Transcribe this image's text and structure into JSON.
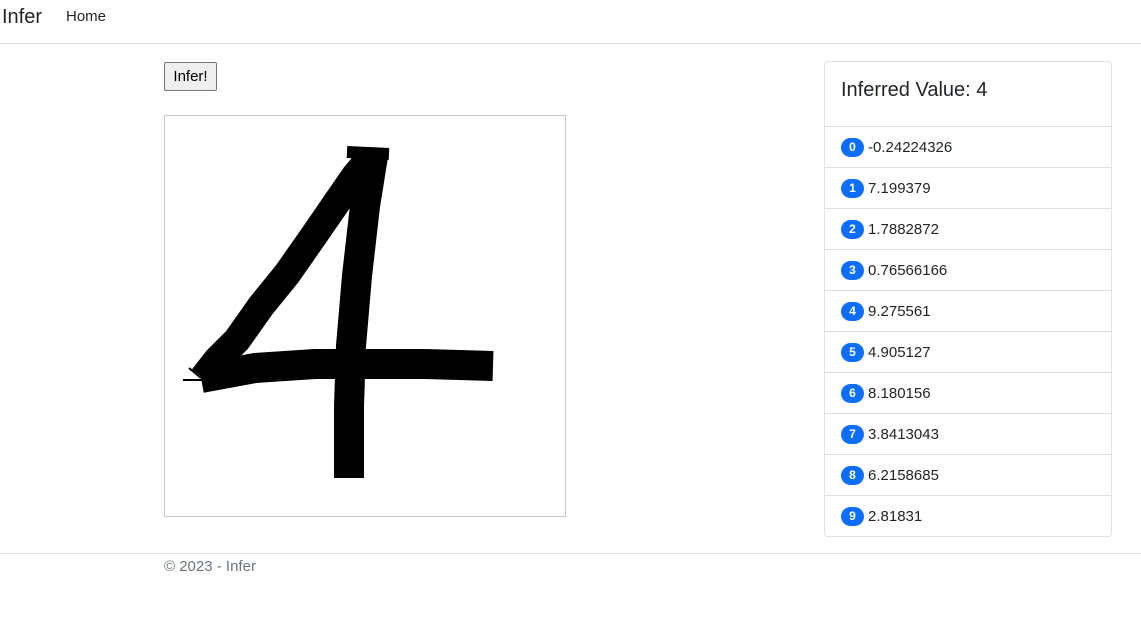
{
  "navbar": {
    "brand": "Infer",
    "links": [
      "Home"
    ]
  },
  "main": {
    "infer_button_label": "Infer!",
    "canvas": {
      "drawn_digit_icon": "handwritten-digit-4"
    }
  },
  "result_card": {
    "title": "Inferred Value: 4",
    "scores": [
      {
        "digit": "0",
        "value": "-0.24224326"
      },
      {
        "digit": "1",
        "value": "7.199379"
      },
      {
        "digit": "2",
        "value": "1.7882872"
      },
      {
        "digit": "3",
        "value": "0.76566166"
      },
      {
        "digit": "4",
        "value": "9.275561"
      },
      {
        "digit": "5",
        "value": "4.905127"
      },
      {
        "digit": "6",
        "value": "8.180156"
      },
      {
        "digit": "7",
        "value": "3.8413043"
      },
      {
        "digit": "8",
        "value": "6.2158685"
      },
      {
        "digit": "9",
        "value": "2.81831"
      }
    ],
    "badge_color": "#0d6efd"
  },
  "footer": {
    "text": "© 2023 - Infer"
  }
}
